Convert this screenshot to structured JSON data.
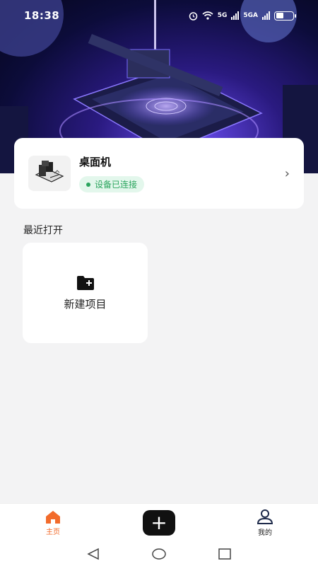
{
  "status_bar": {
    "time": "18:38",
    "net1": "5G",
    "net2": "5GA",
    "battery_level": 0.45
  },
  "device": {
    "name": "桌面机",
    "status": "设备已连接",
    "chevron": "›",
    "status_color": "#2aa45d"
  },
  "recent": {
    "title": "最近打开",
    "new_project_label": "新建项目"
  },
  "tabs": {
    "home": "主页",
    "add": "+",
    "me": "我的",
    "active_color": "#f26b2b"
  },
  "icons": {
    "alarm": "alarm-icon",
    "wifi": "wifi-icon",
    "folder_add": "folder-add-icon",
    "home": "home-icon",
    "profile": "profile-icon"
  }
}
